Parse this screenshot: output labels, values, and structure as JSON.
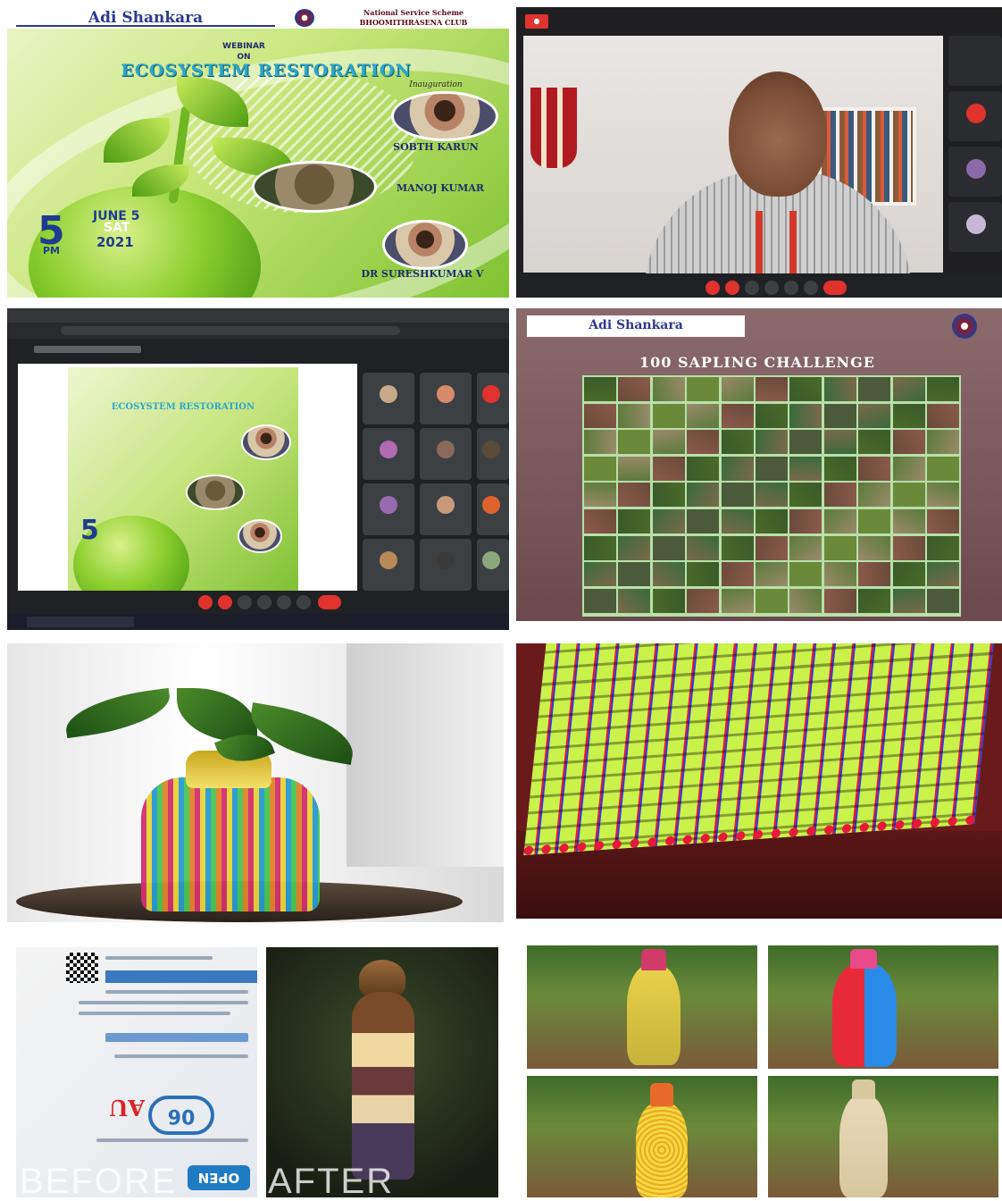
{
  "poster": {
    "institute": "Adi Shankara",
    "nss_line1": "National Service Scheme",
    "nss_line2": "BHOOMITHRASENA CLUB",
    "webinar": "WEBINAR",
    "on": "ON",
    "title": "ECOSYSTEM RESTORATION",
    "inauguration": "Inauguration",
    "speaker1": "SOBTH KARUN",
    "speaker2": "MANOJ KUMAR",
    "speaker3": "DR SURESHKUMAR V",
    "date_day": "5",
    "date_month": "JUNE 5",
    "date_weekday": "SAT",
    "date_year": "2021",
    "time": "PM"
  },
  "sapling": {
    "institute": "Adi Shankara",
    "title": "100 SAPLING CHALLENGE"
  },
  "newspaper": {
    "big_number": "06",
    "open_text": "OPEN"
  },
  "captions": {
    "before": "BEFORE",
    "after": "AFTER"
  },
  "colors": {
    "poster_green": "#7fc230",
    "title_blue": "#2ea6c9",
    "brand_navy": "#2b3b8f",
    "meet_red": "#e0332e"
  }
}
